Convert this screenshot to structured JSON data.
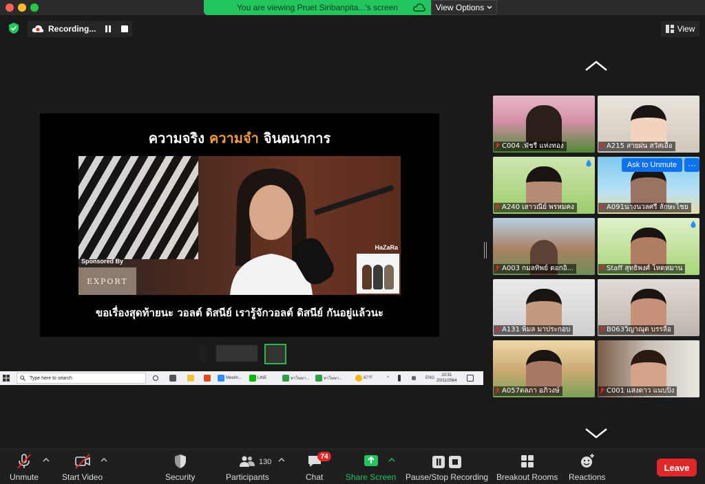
{
  "banner": {
    "text": "You are viewing Pruet Siribanpita...'s screen",
    "view_options": "View Options"
  },
  "recording": {
    "label": "Recording..."
  },
  "view_button": "View",
  "shared": {
    "title_part1": "ความจริง",
    "title_part2": "ความจำ",
    "title_part3": "จินตนาการ",
    "sponsor_label": "Sponsored  By",
    "sponsor_logo": "EXPORT",
    "channel_label": "HaZaRa",
    "subtitle": "ขอเรื่องสุดท้ายนะ วอลต์ ดิสนีย์  เรารู้จักวอลต์ ดิสนีย์ กันอยู่แล้วนะ"
  },
  "taskbar": {
    "search_placeholder": "Type here to search",
    "apps": [
      "Meetin...",
      "LINE",
      "ทาโฆษา...",
      "ทาโฆษา..."
    ],
    "weather": "87°F",
    "lang": "ENG",
    "time": "10:31",
    "date": "20/11/2564"
  },
  "gallery": {
    "tiles": [
      {
        "name": "C004 .พัชรี  แห่งทอง"
      },
      {
        "name": "A215 สายฝน สวัสเอื้อ"
      },
      {
        "name": "A240 เสาวณีย์ พรหมคง"
      },
      {
        "name": "A091นางนวลศรี ลักษะไชย"
      },
      {
        "name": "A003 กมลทิพย์ ดอกอิ..."
      },
      {
        "name": "Staff สุทธิพงศ์ โหดหมาน"
      },
      {
        "name": "A131 พิมล  มาประกอบ"
      },
      {
        "name": "B063วิญาณุต บรรลือ"
      },
      {
        "name": "A057ตลภา  อภิวงษ์"
      },
      {
        "name": "C001 แสงดาว  แนบปิง"
      }
    ],
    "ask_unmute": "Ask to Unmute",
    "more": "···"
  },
  "toolbar": {
    "unmute": "Unmute",
    "start_video": "Start Video",
    "security": "Security",
    "participants": "Participants",
    "participants_count": "130",
    "chat": "Chat",
    "chat_badge": "74",
    "share_screen": "Share Screen",
    "pause_stop": "Pause/Stop Recording",
    "breakout": "Breakout Rooms",
    "reactions": "Reactions",
    "leave": "Leave"
  },
  "colors": {
    "share_green": "#22c55e",
    "leave_red": "#e02828",
    "accent_blue": "#0e72ed",
    "title_orange": "#f39a3f"
  }
}
